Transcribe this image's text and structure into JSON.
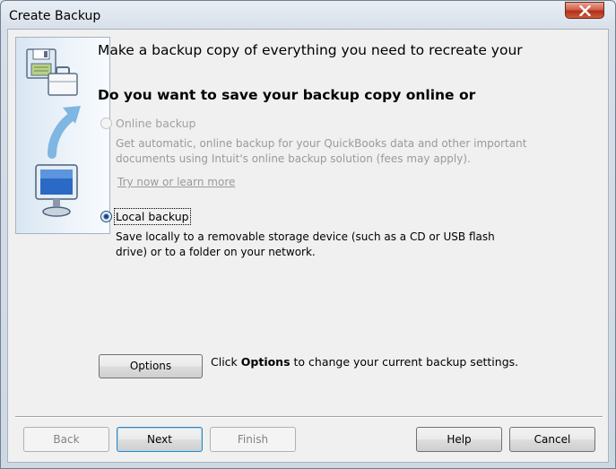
{
  "window": {
    "title": "Create Backup"
  },
  "main": {
    "heading": "Make a backup copy of everything you need to recreate your",
    "question": "Do you want to save your backup copy online or"
  },
  "options": {
    "online": {
      "label": "Online backup",
      "desc_line1": "Get automatic, online backup for your QuickBooks data and other important",
      "desc_line2": "documents using Intuit's online backup solution (fees may apply).",
      "link": "Try now or learn more",
      "selected": false,
      "enabled": false
    },
    "local": {
      "label": "Local backup",
      "desc_line1": "Save locally to a removable storage device (such as a CD or USB flash",
      "desc_line2": "drive) or to a folder on your network.",
      "selected": true,
      "enabled": true
    }
  },
  "options_button": {
    "label": "Options"
  },
  "options_text": {
    "prefix": "Click ",
    "bold": "Options",
    "suffix": " to change your current backup settings."
  },
  "footer": {
    "back": "Back",
    "next": "Next",
    "finish": "Finish",
    "help": "Help",
    "cancel": "Cancel"
  },
  "colors": {
    "close_button": "#c7462f",
    "link_disabled": "#9a9a9a",
    "default_button_border": "#3c7fb1"
  }
}
